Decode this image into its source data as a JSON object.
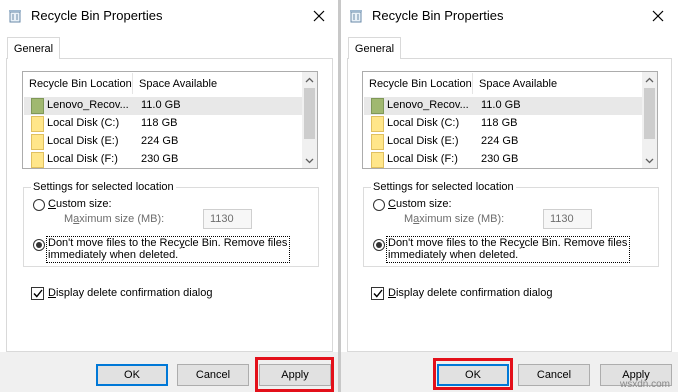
{
  "window_title": "Recycle Bin Properties",
  "tab_label": "General",
  "columns": {
    "location": "Recycle Bin Location",
    "space": "Space Available"
  },
  "locations": [
    {
      "name": "Lenovo_Recov...",
      "space": "11.0 GB",
      "icon": "drive-green-icon"
    },
    {
      "name": "Local Disk (C:)",
      "space": "118 GB",
      "icon": "folder-icon"
    },
    {
      "name": "Local Disk (E:)",
      "space": "224 GB",
      "icon": "folder-icon"
    },
    {
      "name": "Local Disk (F:)",
      "space": "230 GB",
      "icon": "folder-icon"
    }
  ],
  "settings": {
    "group_title": "Settings for selected location",
    "custom_size_c": "C",
    "custom_size_rest": "ustom size:",
    "max_size_pre": "M",
    "max_size_u": "a",
    "max_size_rest": "ximum size (MB):",
    "max_size_value": "1130",
    "dont_move_pre": "Don't move files to the Rec",
    "dont_move_u": "y",
    "dont_move_rest": "cle Bin. Remove files",
    "dont_move_line2": "immediately when deleted.",
    "selected_option": "dont_move",
    "display_confirm_pre": "",
    "display_confirm_u": "D",
    "display_confirm_rest": "isplay delete confirmation dialog",
    "display_confirm_checked": true
  },
  "buttons": {
    "ok": "OK",
    "cancel": "Cancel",
    "apply": "Apply"
  },
  "watermark": "wsxdn.com",
  "colors": {
    "highlight": "#e3101a",
    "default_button_border": "#0078d7",
    "drive_green": "#a0b870",
    "folder_yellow": "#ffe68a"
  }
}
